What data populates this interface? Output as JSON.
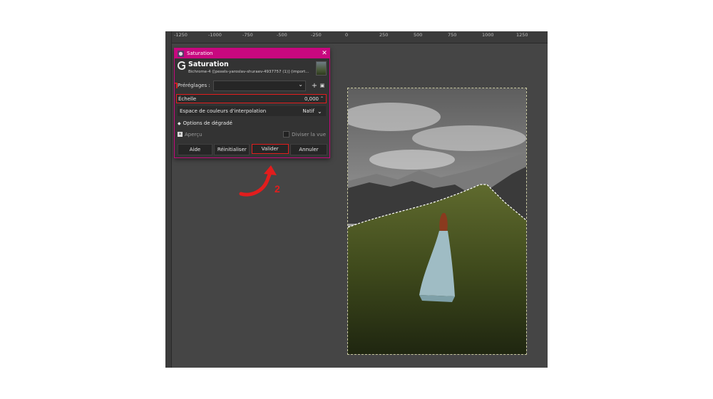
{
  "ruler": {
    "ticks": [
      "-1250",
      "-1000",
      "-750",
      "-500",
      "-250",
      "0",
      "250",
      "500",
      "750",
      "1000",
      "1250"
    ]
  },
  "dialog": {
    "window_title": "Saturation",
    "header_title": "Saturation",
    "subtitle": "Bichrome-4 ([pexels-yaroslav-shuraev-4937757 (1)] (import...",
    "presets_label": "Préréglages :",
    "scale_label": "Échelle",
    "scale_value": "0,000",
    "interp_label": "Espace de couleurs d'interpolation",
    "interp_value": "Natif",
    "blend_options": "Options de dégradé",
    "preview_label": "Aperçu",
    "split_label": "Diviser la vue",
    "buttons": {
      "help": "Aide",
      "reset": "Réinitialiser",
      "ok": "Valider",
      "cancel": "Annuler"
    }
  },
  "annotations": {
    "step1": "1",
    "step2": "2",
    "accent": "#e21d1d"
  },
  "colors": {
    "titlebar": "#c8087f",
    "dialog_bg": "#333333",
    "canvas_bg": "#454545"
  }
}
